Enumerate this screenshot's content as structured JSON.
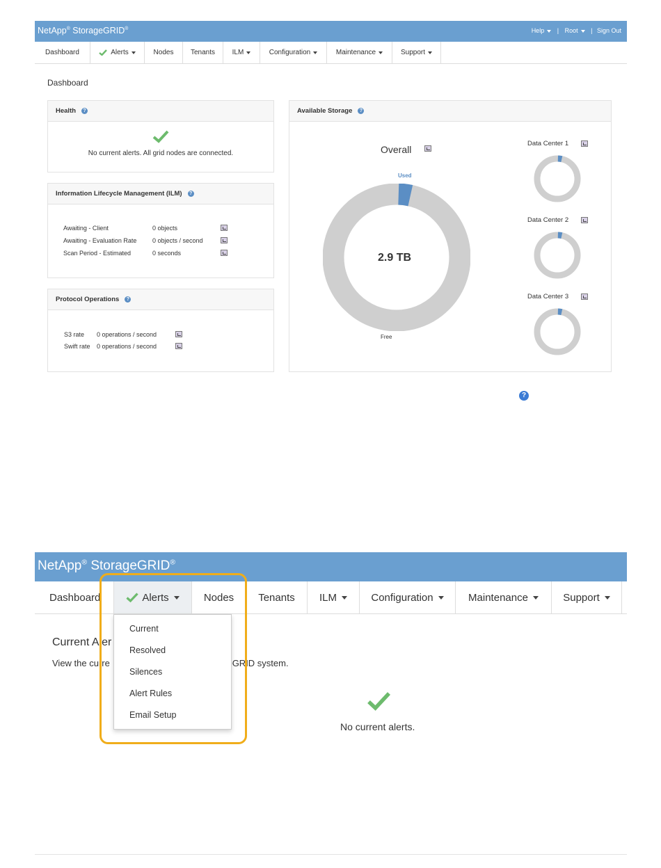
{
  "brand": {
    "name": "NetApp",
    "product": "StorageGRID",
    "reg": "®"
  },
  "user_links": {
    "help": "Help",
    "root": "Root",
    "sign_out": "Sign Out",
    "sep": "|"
  },
  "nav": {
    "dashboard": "Dashboard",
    "alerts": "Alerts",
    "nodes": "Nodes",
    "tenants": "Tenants",
    "ilm": "ILM",
    "configuration": "Configuration",
    "maintenance": "Maintenance",
    "support": "Support"
  },
  "dashboard": {
    "title": "Dashboard",
    "health": {
      "title": "Health",
      "message": "No current alerts. All grid nodes are connected."
    },
    "ilm": {
      "title": "Information Lifecycle Management (ILM)",
      "rows": [
        {
          "label": "Awaiting - Client",
          "value": "0 objects"
        },
        {
          "label": "Awaiting - Evaluation Rate",
          "value": "0 objects / second"
        },
        {
          "label": "Scan Period - Estimated",
          "value": "0 seconds"
        }
      ]
    },
    "protocol": {
      "title": "Protocol Operations",
      "rows": [
        {
          "label": "S3 rate",
          "value": "0 operations / second"
        },
        {
          "label": "Swift rate",
          "value": "0 operations / second"
        }
      ]
    },
    "storage": {
      "title": "Available Storage",
      "overall": {
        "title": "Overall",
        "center": "2.9 TB",
        "used_label": "Used",
        "free_label": "Free",
        "used_fraction": 0.03
      },
      "data_centers": [
        {
          "title": "Data Center 1",
          "used_fraction": 0.03
        },
        {
          "title": "Data Center 2",
          "used_fraction": 0.03
        },
        {
          "title": "Data Center 3",
          "used_fraction": 0.03
        }
      ]
    }
  },
  "alerts_page": {
    "title": "Current Aler",
    "description_left": "View the curre",
    "description_right": "ageGRID system.",
    "empty_message": "No current alerts.",
    "menu": [
      "Current",
      "Resolved",
      "Silences",
      "Alert Rules",
      "Email Setup"
    ]
  },
  "colors": {
    "banner": "#6a9fd0",
    "used": "#5b8ec4",
    "free": "#cfcfcf",
    "check": "#6dbb6d",
    "highlight": "#f0ad1a"
  }
}
